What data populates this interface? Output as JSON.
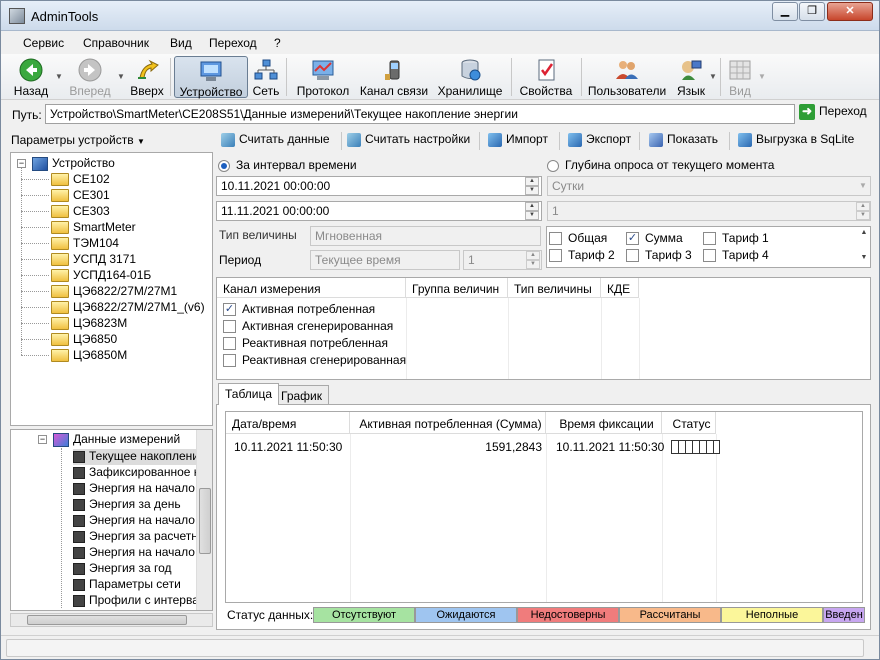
{
  "window": {
    "title": "AdminTools",
    "minimize_label": "▁",
    "restore_label": "❐",
    "close_label": "✕"
  },
  "menu": [
    "Сервис",
    "Справочник",
    "Вид",
    "Переход",
    "?"
  ],
  "toolbar": {
    "back_label": "Назад",
    "forward_label": "Вперед",
    "up_label": "Вверх",
    "device_label": "Устройство",
    "network_label": "Сеть",
    "protocol_label": "Протокол",
    "channel_label": "Канал связи",
    "storage_label": "Хранилище",
    "properties_label": "Свойства",
    "users_label": "Пользователи",
    "language_label": "Язык",
    "view_label": "Вид"
  },
  "path": {
    "label": "Путь:",
    "value": "Устройство\\SmartMeter\\CE208S51\\Данные измерений\\Текущее накопление энергии",
    "go_label": "Переход"
  },
  "left_panel": {
    "header": "Параметры устройств",
    "tree_root": "Устройство",
    "devices": [
      "CE102",
      "CE301",
      "CE303",
      "SmartMeter",
      "ТЭМ104",
      "УСПД 3171",
      "УСПД164-01Б",
      "ЦЭ6822/27М/27М1",
      "ЦЭ6822/27М/27М1_(v6)",
      "ЦЭ6823М",
      "ЦЭ6850",
      "ЦЭ6850М"
    ],
    "sub_root": "Данные измерений",
    "sub_items": [
      "Текущее накопление",
      "Зафиксированное на",
      "Энергия на начало д",
      "Энергия за день",
      "Энергия на начало р",
      "Энергия за расчетн",
      "Энергия на начало г",
      "Энергия за год",
      "Параметры сети",
      "Профили с интервал"
    ]
  },
  "actions": {
    "read_data": "Считать данные",
    "read_settings": "Считать настройки",
    "import": "Импорт",
    "export": "Экспорт",
    "show": "Показать",
    "sqlite": "Выгрузка в SqLite"
  },
  "filter": {
    "interval_label": "За интервал времени",
    "depth_label": "Глубина опроса от текущего момента",
    "date_from": "10.11.2021 00:00:00",
    "date_to": "11.11.2021 00:00:00",
    "depth_unit": "Сутки",
    "depth_value": "1",
    "value_type_label": "Тип величины",
    "value_type": "Мгновенная",
    "period_label": "Период",
    "period_value": "Текущее время",
    "period_count": "1"
  },
  "tariffs": [
    {
      "label": "Общая",
      "checked": false
    },
    {
      "label": "Сумма",
      "checked": true
    },
    {
      "label": "Тариф 1",
      "checked": false
    },
    {
      "label": "Тариф 2",
      "checked": false
    },
    {
      "label": "Тариф 3",
      "checked": false
    },
    {
      "label": "Тариф 4",
      "checked": false
    }
  ],
  "channels_grid": {
    "headers": [
      "Канал измерения",
      "Группа величин",
      "Тип величины",
      "КДЕ"
    ],
    "rows": [
      {
        "label": "Активная потребленная",
        "checked": true
      },
      {
        "label": "Активная сгенерированная",
        "checked": false
      },
      {
        "label": "Реактивная потребленная",
        "checked": false
      },
      {
        "label": "Реактивная сгенерированная",
        "checked": false
      }
    ]
  },
  "tabs": [
    "Таблица",
    "График"
  ],
  "results": {
    "headers": [
      "Дата/время",
      "Активная потребленная (Сумма)",
      "Время фиксации",
      "Статус"
    ],
    "rows": [
      {
        "datetime": "10.11.2021 11:50:30",
        "value": "1591,2843",
        "fixed_time": "10.11.2021 11:50:30"
      }
    ]
  },
  "data_status": {
    "label": "Статус данных:",
    "items": [
      {
        "label": "Отсутствуют",
        "color": "#a6e3a1"
      },
      {
        "label": "Ожидаются",
        "color": "#9fc5f0"
      },
      {
        "label": "Недостоверны",
        "color": "#f07c7c"
      },
      {
        "label": "Рассчитаны",
        "color": "#f8b98a"
      },
      {
        "label": "Неполные",
        "color": "#fbf69a"
      },
      {
        "label": "Введен",
        "color": "#c7a6f0"
      }
    ]
  }
}
